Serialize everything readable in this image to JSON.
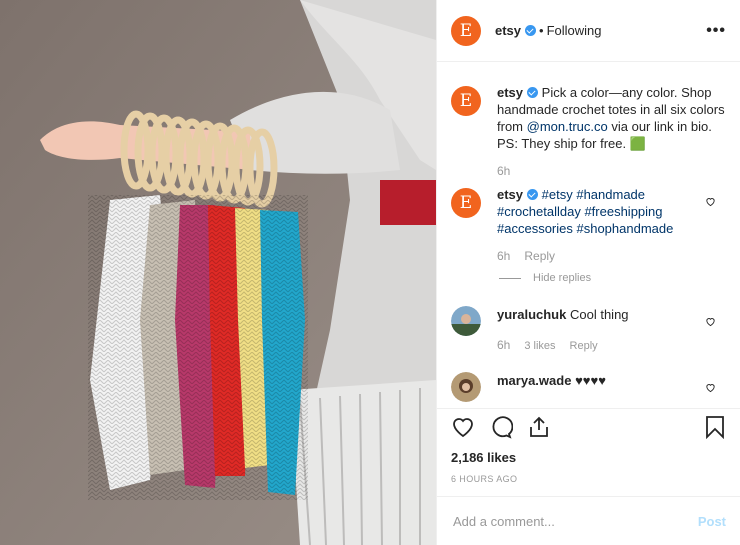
{
  "header": {
    "avatar_letter": "E",
    "username": "etsy",
    "separator": "•",
    "follow_status": "Following",
    "more": "•••"
  },
  "caption": {
    "avatar_letter": "E",
    "username": "etsy",
    "text_before_mention": "Pick a color—any color. Shop handmade crochet totes in all six colors from ",
    "mention": "@mon.truc.co",
    "text_after_mention": " via our link in bio. PS: They ship for free. 🟩",
    "time": "6h"
  },
  "comment1": {
    "avatar_letter": "E",
    "username": "etsy",
    "hashtags": "#etsy #handmade #crochetallday #freeshipping #accessories #shophandmade",
    "time": "6h",
    "reply": "Reply",
    "hide_replies": "Hide replies"
  },
  "comment2": {
    "username": "yuraluchuk",
    "text": "Cool thing",
    "time": "6h",
    "likes": "3 likes",
    "reply": "Reply"
  },
  "comment3": {
    "username": "marya.wade",
    "text": "♥♥♥♥"
  },
  "likes_count": "2,186 likes",
  "timestamp": "6 HOURS AGO",
  "add_comment": {
    "placeholder": "Add a comment...",
    "post_label": "Post"
  },
  "colors": {
    "etsy_orange": "#f1641e",
    "link_blue": "#003569",
    "verified": "#3897f0"
  }
}
